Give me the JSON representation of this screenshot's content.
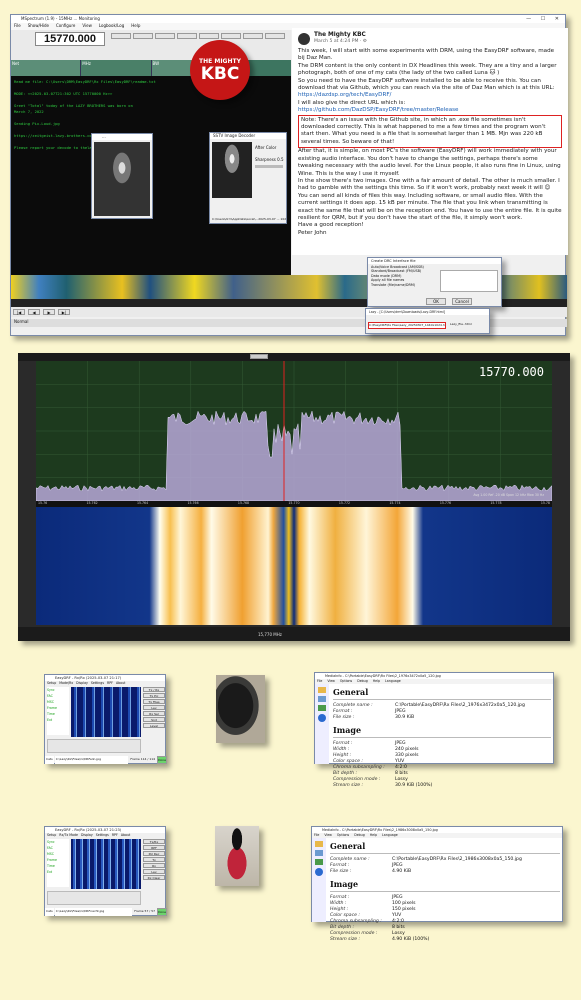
{
  "top_window": {
    "title": "MSpectrum (1.9) - 15MHz ... Monitoring",
    "menu": [
      "File",
      "Show/Hide",
      "Configure",
      "View",
      "Logbook/Log",
      "Help"
    ],
    "frequency": "15770.000",
    "lcd_labels": [
      "Net",
      "MHz",
      "BW",
      "Offset"
    ],
    "terminal_lines": [
      "Read me file: C:\\Users\\DRM\\EasyDRF\\Rx Files\\EasyDRF\\readme.txt",
      "",
      "MODE: <<2025-03-07T21:302 UTC 15770000 Hz>>",
      "",
      "Greet \"Total\" today of the LAZY BROTHERS was born on",
      "March 7, 2022",
      "",
      "Sending Pix-Loud.jpg",
      "",
      "https://zeitgeist.lazy-brothers.com",
      "",
      "Please report your decode to thelazybros@gmail.com"
    ],
    "photo_window_title": "...",
    "sstv_window_title": "SSTV Image Decoder",
    "sstv_options": [
      "After Color",
      "Sharpness 0.5"
    ],
    "sstv_status": "C:\\Users\\drm\\AppData\\Local\\...2025-03-07 ... 1020x2048.jpg",
    "status_bar": "Normal"
  },
  "logo": {
    "line1": "THE MIGHTY",
    "line2": "KBC"
  },
  "post": {
    "author": "The Mighty KBC",
    "date": "March 5 at 4:24 PM · ⚙",
    "p1": "This week, I will start with some experiments with DRM, using the EasyDRF software, made bij Daz Man.",
    "p2": "The DRM content is the only content in DX Headlines this week. They are a tiny and a larger photograph, both of one of my cats (the lady of the two called Luna 🐱 )",
    "p3": "So you need to have the EasyDRF software installed to be able to receive this. You can download that via Github, which you can reach via the site of Daz Man which is at this URL:",
    "link1": "https://dazdsp.org/tech/EasyDRF/",
    "p4": "I will also give the direct URL which is:",
    "link2": "https://github.com/DazDSP/EasyDRF/tree/master/Release",
    "note": "Note: There's an issue with the Github site, in which an .exe file sometimes isn't downloaded correctly. This is what happened to me a few times and the program won't start then. What you need is a file that is somewhat larger than 1 MB. Mjn was 220 kB several times. So beware of that!",
    "p5": "After that, it is simple, on most PC's the software (EasyDRF) will work immediately with your existing audio interface. You don't have to change the settings, perhaps there's some tweaking necessary with the audio level. For the Linux people, it also runs fine in Linux, using Wine. This is the way I use it myself.",
    "p6": "In the show there's two images. One with a fair amount of detail. The other is much smaller. I had to gamble with the settings this time. So if it won't work, probably next week it will 😊",
    "p7": "You can send all kinds of files this way. Including software, or small audio files. With the current settings it does app. 15 kB per minute. The file that you link when transmitting is exact the same file that will be on the reception end. You have to use the entire file. It is quite resilient for QRM, but if you don't have the start of the file, it simply won't work.",
    "p8": "Have a good reception!",
    "p9": "Peter John"
  },
  "dialog1": {
    "title": "Create DRC Interface file",
    "options": [
      "Auto/Voice Broadcast (AM/SSB)",
      "Standard/Broadcast (FM/USB)",
      "Data mode (DRM)",
      "Apply all file names",
      "Translate (file/name/DRM)"
    ],
    "ok": "OK",
    "cancel": "Cancel"
  },
  "dialog2": {
    "title": "Lazy - [C:\\Users\\drm\\Downloads\\Lazy-DRF.html]",
    "path": "C:\\EasyDRF\\Rx Files\\Lazy_20250307_1440x1024.html",
    "file": "Lazy_file..html"
  },
  "waterfall": {
    "title": "15770.000",
    "marker": "15770.000",
    "freq_ticks": [
      "15.76",
      "15.762",
      "15.764",
      "15.766",
      "15.768",
      "15.770",
      "15.772",
      "15.774",
      "15.776",
      "15.778",
      "15.78"
    ],
    "bottom_label": "15,770 MHz",
    "legend": "Avg 1.00 Ref -20 dB Span 12 kHz Rbw 30 Hz"
  },
  "drm1": {
    "title": "EasyDRF - Rx/Rx (2025-03-07 21:17)",
    "menu": [
      "Setup",
      "Mode/Rx",
      "Display",
      "Settings",
      "RPF",
      "About"
    ],
    "status_items": [
      "Sync",
      "FAC",
      "MSC",
      "Frame",
      "Time",
      "Ext"
    ],
    "right_buttons": [
      "Tx / Rx",
      "Tx Pic",
      "Tx Files",
      "Lev",
      "Rx Sel",
      "Snd",
      "Level"
    ],
    "bottom_label": "Cats",
    "bottom_path": "C:\\Lazy\\Rx\\Files\\rx\\DRFelin.jpg",
    "bottom_status": "Frame 114 / 114",
    "ok": "Done"
  },
  "drm2": {
    "title": "EasyDRF - Rx/Rx (2025-03-07 21:23)",
    "menu": [
      "Setup",
      "Rx/Tx Mode",
      "Display",
      "Settings",
      "RPF",
      "About"
    ],
    "status_items": [
      "Sync",
      "FAC",
      "MSC",
      "Frame",
      "Time",
      "Ext"
    ],
    "right_buttons": [
      "Tx/Rx",
      "RPF",
      "Pol Rec",
      "Tx",
      "Rx",
      "Lev",
      "Rx Clear"
    ],
    "bottom_label": "Cats",
    "bottom_path": "C:\\Lazy\\Rx\\Files\\rx\\DRFnacht.jpg",
    "bottom_status": "Frame 57 / 57",
    "ok": "Done"
  },
  "info1": {
    "title": "MediaInfo - C:\\Portable\\EasyDRF\\Rx Files\\2_1976x3472x0a5_120.jpg",
    "menu": [
      "File",
      "View",
      "Options",
      "Debug",
      "Help",
      "Language"
    ],
    "general_title": "General",
    "general_rows": [
      {
        "k": "Complete name :",
        "v": "C:\\Portable\\EasyDRF\\Rx Files\\2_1976x3472x0a5_120.jpg"
      },
      {
        "k": "Format :",
        "v": "JPEG"
      },
      {
        "k": "File size :",
        "v": "30.9 KiB"
      }
    ],
    "image_title": "Image",
    "image_rows": [
      {
        "k": "Format :",
        "v": "JPEG"
      },
      {
        "k": "Width :",
        "v": "240 pixels"
      },
      {
        "k": "Height :",
        "v": "330 pixels"
      },
      {
        "k": "Color space :",
        "v": "YUV"
      },
      {
        "k": "Chroma subsampling :",
        "v": "4:2:0"
      },
      {
        "k": "Bit depth :",
        "v": "8 bits"
      },
      {
        "k": "Compression mode :",
        "v": "Lossy"
      },
      {
        "k": "Stream size :",
        "v": "30.9 KiB (100%)"
      }
    ]
  },
  "info2": {
    "title": "MediaInfo - C:\\Portable\\EasyDRF\\Rx Files\\2_1986x3008x0a5_150.jpg",
    "menu": [
      "File",
      "View",
      "Options",
      "Debug",
      "Help",
      "Language"
    ],
    "general_title": "General",
    "general_rows": [
      {
        "k": "Complete name :",
        "v": "C:\\Portable\\EasyDRF\\Rx Files\\2_1986x3008x0a5_150.jpg"
      },
      {
        "k": "Format :",
        "v": "JPEG"
      },
      {
        "k": "File size :",
        "v": "4.90 KiB"
      }
    ],
    "image_title": "Image",
    "image_rows": [
      {
        "k": "Format :",
        "v": "JPEG"
      },
      {
        "k": "Width :",
        "v": "100 pixels"
      },
      {
        "k": "Height :",
        "v": "150 pixels"
      },
      {
        "k": "Color space :",
        "v": "YUV"
      },
      {
        "k": "Chroma subsampling :",
        "v": "4:2:0"
      },
      {
        "k": "Bit depth :",
        "v": "8 bits"
      },
      {
        "k": "Compression mode :",
        "v": "Lossy"
      },
      {
        "k": "Stream size :",
        "v": "4.90 KiB (100%)"
      }
    ]
  },
  "colors": {
    "background": "#fbf6cf",
    "accent_red": "#c51616",
    "terminal_green": "#2ecc40",
    "link_blue": "#1b5fb4"
  }
}
